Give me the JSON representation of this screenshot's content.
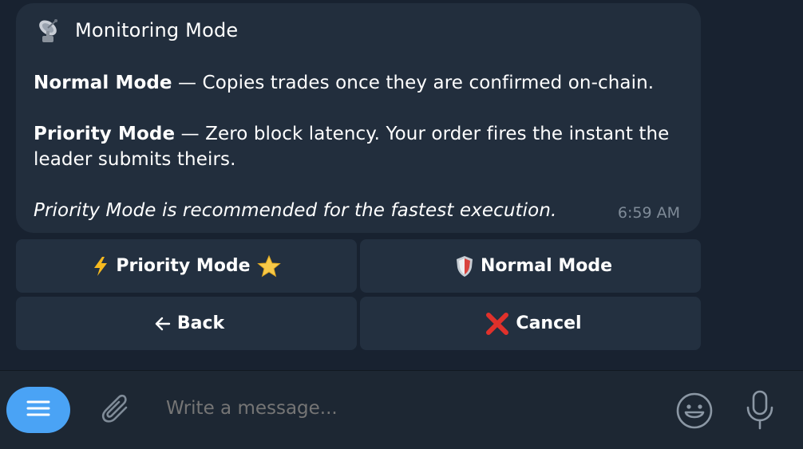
{
  "message": {
    "title": "Monitoring Mode",
    "title_icon": "satellite-antenna-icon",
    "normal_label": "Normal Mode",
    "normal_desc": " — Copies trades once they are confirmed on-chain.",
    "priority_label": "Priority Mode",
    "priority_desc": " — Zero block latency. Your order fires the instant the leader submits theirs.",
    "note": "Priority Mode is recommended for the fastest execution.",
    "time": "6:59 AM"
  },
  "keyboard": {
    "priority": {
      "label": "Priority Mode",
      "left_icon": "lightning-icon",
      "right_icon": "star-icon"
    },
    "normal": {
      "label": "Normal Mode",
      "icon": "shield-icon"
    },
    "back": {
      "label": "Back",
      "icon": "left-arrow-icon"
    },
    "cancel": {
      "label": "Cancel",
      "icon": "cross-mark-icon"
    }
  },
  "composer": {
    "placeholder": "Write a message...",
    "colors": {
      "accent": "#4aa3f5",
      "background": "#182230",
      "bubble": "#222e3d"
    }
  }
}
